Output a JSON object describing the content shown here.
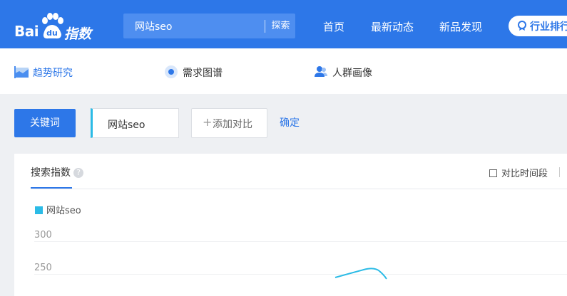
{
  "header": {
    "logo_bai": "Bai",
    "logo_du": "du",
    "logo_zhishu": "指数",
    "search_value": "网站seo",
    "search_button": "探索",
    "nav": [
      "首页",
      "最新动态",
      "新品发现"
    ],
    "rank_button": "行业排行",
    "colors": {
      "brand": "#2d77e8",
      "accent": "#2bbbe6"
    }
  },
  "subnav": {
    "items": [
      {
        "label": "趋势研究",
        "icon": "trend-chart-icon"
      },
      {
        "label": "需求图谱",
        "icon": "radio-target-icon"
      },
      {
        "label": "人群画像",
        "icon": "people-icon"
      }
    ]
  },
  "toolbar": {
    "keyword_button": "关键词",
    "keyword_value": "网站seo",
    "add_compare": "添加对比",
    "confirm": "确定"
  },
  "panel": {
    "tab_label": "搜索指数",
    "help_icon": "?",
    "compare_period": "对比时间段",
    "legend": "网站seo",
    "y_ticks": [
      "300",
      "250"
    ]
  }
}
